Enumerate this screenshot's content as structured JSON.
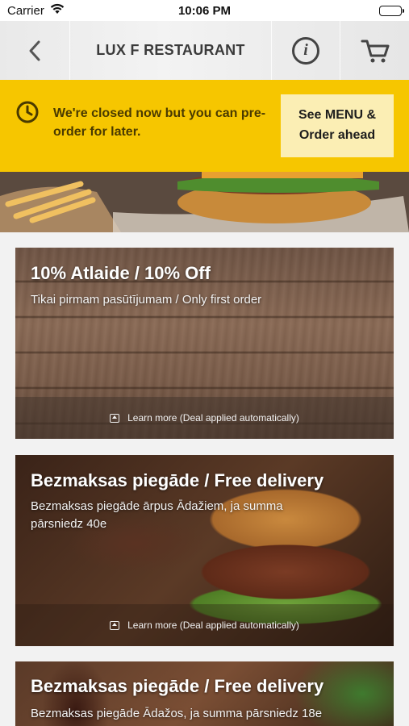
{
  "status_bar": {
    "carrier": "Carrier",
    "time": "10:06 PM"
  },
  "nav": {
    "title": "LUX F RESTAURANT",
    "back_icon": "chevron-left-icon",
    "info_icon": "info-icon",
    "cart_icon": "cart-icon"
  },
  "banner": {
    "message": "We're closed now but you can pre-order for later.",
    "button_label": "See MENU & Order ahead",
    "color": "#f6c600"
  },
  "deals": [
    {
      "title": "10% Atlaide / 10% Off",
      "subtitle": "Tikai pirmam pasūtījumam / Only first order",
      "footer": "Learn more (Deal applied automatically)"
    },
    {
      "title": "Bezmaksas piegāde / Free delivery",
      "subtitle": "Bezmaksas piegāde ārpus Ādažiem, ja summa pārsniedz 40e",
      "footer": "Learn more (Deal applied automatically)"
    },
    {
      "title": "Bezmaksas piegāde / Free delivery",
      "subtitle": "Bezmaksas piegāde Ādažos, ja summa pārsniedz 18e"
    }
  ]
}
